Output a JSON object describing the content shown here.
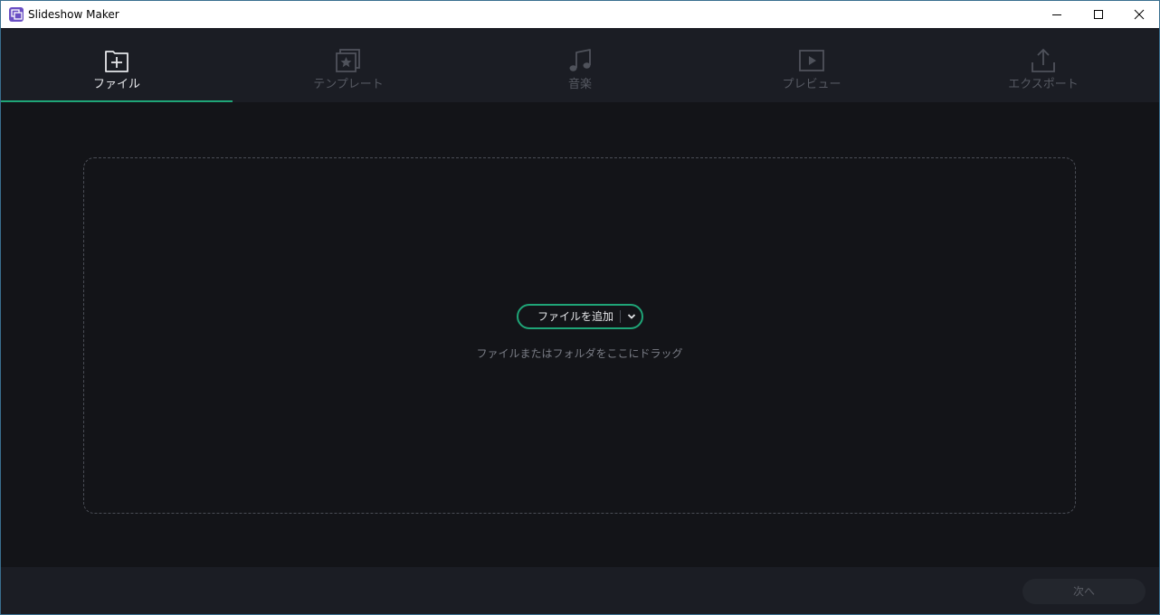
{
  "window": {
    "title": "Slideshow Maker",
    "icon": "app-logo-icon"
  },
  "window_controls": {
    "minimize_icon": "minimize-icon",
    "maximize_icon": "maximize-icon",
    "close_icon": "close-icon"
  },
  "tabs": [
    {
      "label": "ファイル",
      "icon": "folder-add-icon",
      "active": true
    },
    {
      "label": "テンプレート",
      "icon": "template-star-icon",
      "active": false
    },
    {
      "label": "音楽",
      "icon": "music-note-icon",
      "active": false
    },
    {
      "label": "プレビュー",
      "icon": "play-preview-icon",
      "active": false
    },
    {
      "label": "エクスポート",
      "icon": "export-upload-icon",
      "active": false
    }
  ],
  "dropzone": {
    "add_button_label": "ファイルを追加",
    "dropdown_icon": "chevron-down-icon",
    "hint": "ファイルまたはフォルダをここにドラッグ"
  },
  "footer": {
    "next_label": "次へ"
  },
  "colors": {
    "accent": "#1fa577",
    "background": "#131418",
    "panel": "#1b1d24",
    "text_active": "#e6e7ea",
    "text_inactive": "#565962"
  }
}
